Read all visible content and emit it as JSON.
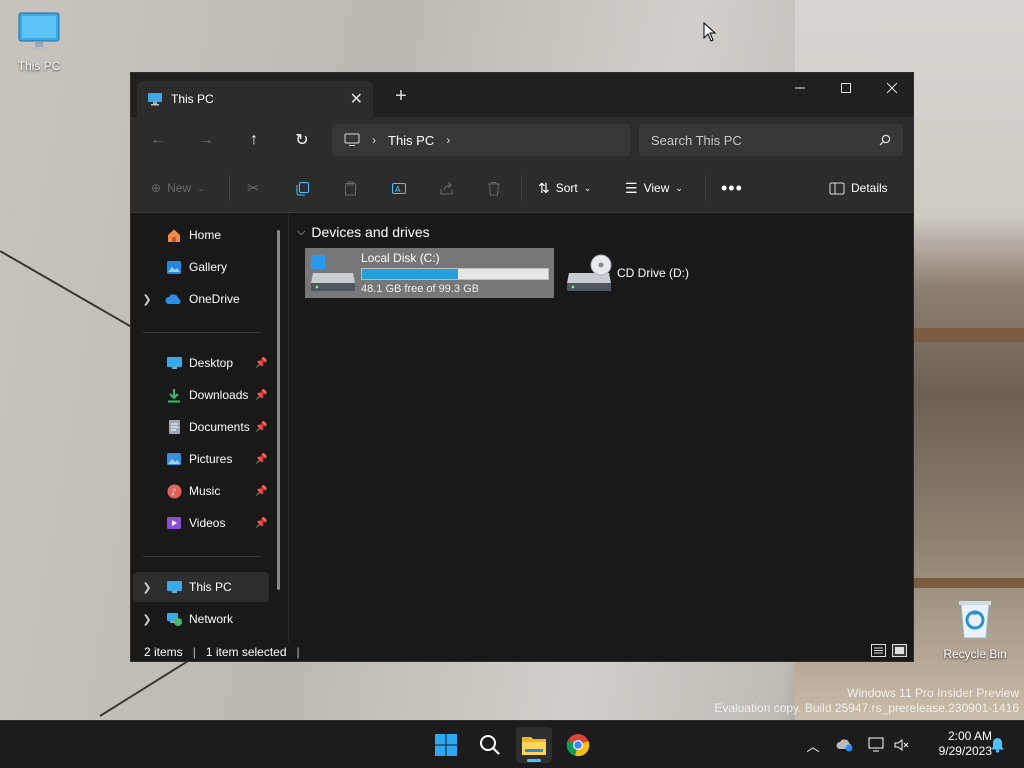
{
  "desktop": {
    "icons": [
      {
        "label": "This PC",
        "icon": "monitor-icon"
      },
      {
        "label": "Recycle Bin",
        "icon": "recycle-bin-icon"
      }
    ]
  },
  "window": {
    "tab_title": "This PC",
    "nav": {
      "breadcrumb": [
        "This PC"
      ],
      "search_placeholder": "Search This PC"
    },
    "toolbar": {
      "new_label": "New",
      "sort_label": "Sort",
      "view_label": "View",
      "details_label": "Details"
    },
    "sidebar": {
      "top": [
        {
          "label": "Home",
          "icon": "home-icon"
        },
        {
          "label": "Gallery",
          "icon": "gallery-icon"
        },
        {
          "label": "OneDrive",
          "icon": "cloud-icon"
        }
      ],
      "pinned": [
        {
          "label": "Desktop",
          "icon": "desktop-folder-icon"
        },
        {
          "label": "Downloads",
          "icon": "download-icon"
        },
        {
          "label": "Documents",
          "icon": "document-icon"
        },
        {
          "label": "Pictures",
          "icon": "pictures-icon"
        },
        {
          "label": "Music",
          "icon": "music-icon"
        },
        {
          "label": "Videos",
          "icon": "video-icon"
        }
      ],
      "bottom": [
        {
          "label": "This PC",
          "icon": "monitor-icon",
          "selected": true
        },
        {
          "label": "Network",
          "icon": "network-icon"
        }
      ]
    },
    "content": {
      "group_title": "Devices and drives",
      "drives": [
        {
          "name": "Local Disk (C:)",
          "free_text": "48.1 GB free of 99.3 GB",
          "used_fraction": 0.516,
          "selected": true
        },
        {
          "name": "CD Drive (D:)",
          "selected": false
        }
      ]
    },
    "status": {
      "items_count": "2 items",
      "selection": "1 item selected"
    }
  },
  "watermark": {
    "line1": "Windows 11 Pro Insider Preview",
    "line2": "Evaluation copy. Build 25947.rs_prerelease.230901-1416"
  },
  "taskbar": {
    "time": "2:00 AM",
    "date": "9/29/2023"
  },
  "colors": {
    "accent": "#26a0da",
    "window_bg": "#191919",
    "taskbar_bg": "#1c1c1c"
  }
}
